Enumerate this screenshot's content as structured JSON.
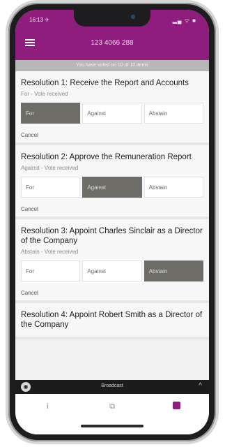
{
  "status_bar": {
    "time": "16:13 ✈",
    "icons": "▂▄ ᯤ ■"
  },
  "header": {
    "title": "123 4066 288"
  },
  "notice": "You have voted on 10 of 10 items",
  "resolutions": [
    {
      "title": "Resolution 1: Receive the Report and Accounts",
      "status": "For - Vote received",
      "options": [
        "For",
        "Against",
        "Abstain"
      ],
      "selected": 0,
      "cancel_label": "Cancel"
    },
    {
      "title": "Resolution 2: Approve the Remuneration Report",
      "status": "Against - Vote received",
      "options": [
        "For",
        "Against",
        "Abstain"
      ],
      "selected": 1,
      "cancel_label": "Cancel"
    },
    {
      "title": "Resolution 3: Appoint Charles Sinclair as a Director of the Company",
      "status": "Abstain - Vote received",
      "options": [
        "For",
        "Against",
        "Abstain"
      ],
      "selected": 2,
      "cancel_label": "Cancel"
    },
    {
      "title": "Resolution 4: Appoint Robert Smith as a Director of the Company",
      "status": "",
      "options": [],
      "selected": -1,
      "cancel_label": ""
    }
  ],
  "player": {
    "label": "Broadcast",
    "chevron": "^"
  },
  "tabs": [
    {
      "name": "info",
      "glyph": "i"
    },
    {
      "name": "messages",
      "glyph": "⧉"
    },
    {
      "name": "voting",
      "glyph": ""
    }
  ],
  "colors": {
    "brand": "#8e1d7e",
    "selected": "#6d6c67"
  }
}
